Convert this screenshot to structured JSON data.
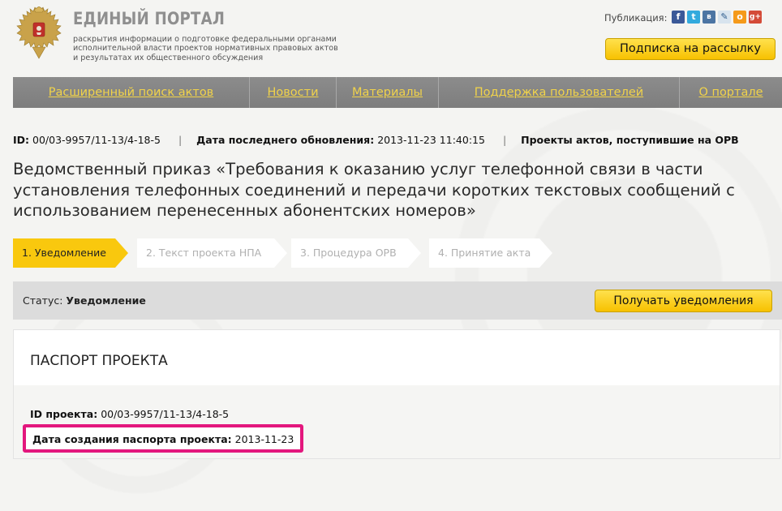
{
  "header": {
    "title": "ЕДИНЫЙ ПОРТАЛ",
    "subtitle_lines": [
      "раскрытия информации о подготовке федеральными органами",
      "исполнительной власти проектов нормативных правовых актов",
      "и результатах их общественного обсуждения"
    ],
    "publication_label": "Публикация:",
    "social_icons": [
      "facebook-icon",
      "twitter-icon",
      "vkontakte-icon",
      "livejournal-icon",
      "odnoklassniki-icon",
      "google-plus-icon"
    ],
    "subscribe_button": "Подписка на рассылку"
  },
  "nav": {
    "items": [
      "Расширенный поиск актов",
      "Новости",
      "Материалы",
      "Поддержка пользователей",
      "О портале"
    ]
  },
  "meta": {
    "id_label": "ID:",
    "id_value": "00/03-9957/11-13/4-18-5",
    "updated_label": "Дата последнего обновления:",
    "updated_value": "2013-11-23 11:40:15",
    "category": "Проекты актов, поступившие на ОРВ"
  },
  "document": {
    "title": "Ведомственный приказ «Требования к оказанию услуг телефонной связи в части установления телефонных соединений и передачи коротких текстовых сообщений с использованием перенесенных абонентских номеров»"
  },
  "steps": [
    {
      "label": "1. Уведомление",
      "active": true
    },
    {
      "label": "2. Текст проекта НПА",
      "active": false
    },
    {
      "label": "3. Процедура ОРВ",
      "active": false
    },
    {
      "label": "4. Принятие акта",
      "active": false
    }
  ],
  "status": {
    "label": "Статус:",
    "value": "Уведомление",
    "notify_button": "Получать уведомления"
  },
  "passport": {
    "title": "ПАСПОРТ ПРОЕКТА",
    "project_id_label": "ID проекта:",
    "project_id_value": "00/03-9957/11-13/4-18-5",
    "created_label": "Дата создания паспорта проекта:",
    "created_value": "2013-11-23"
  },
  "colors": {
    "accent_yellow": "#f9c80e",
    "nav_gray": "#858585",
    "nav_link": "#f1d34a",
    "highlight": "#e3177d"
  }
}
